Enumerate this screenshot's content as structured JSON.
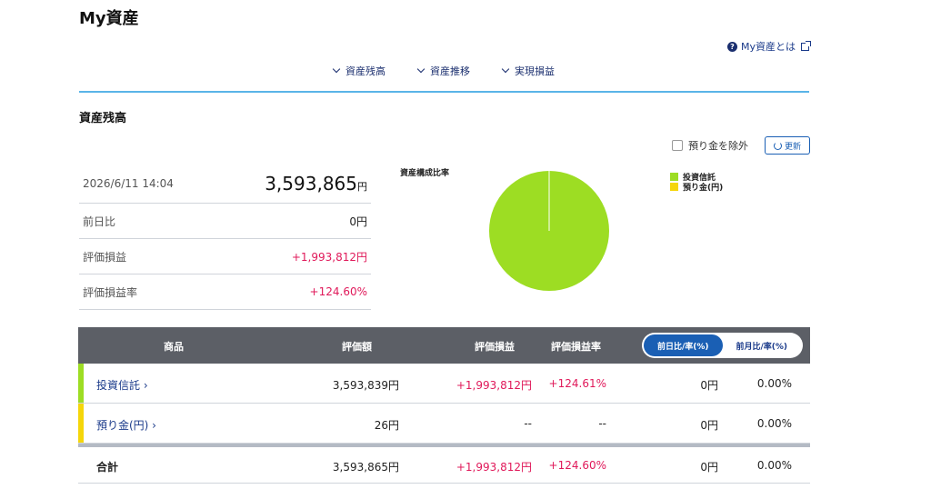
{
  "page": {
    "title": "My資産"
  },
  "help": {
    "label": "My資産とは",
    "icon": "help-icon",
    "external_icon": "external-link-icon"
  },
  "anchor_nav": [
    {
      "label": "資産残高"
    },
    {
      "label": "資産推移"
    },
    {
      "label": "実現損益"
    }
  ],
  "section": {
    "title": "資産残高"
  },
  "controls": {
    "exclude_label": "預り金を除外",
    "refresh_label": "更新"
  },
  "summary": {
    "datetime": "2026/6/11 14:04",
    "total_value": "3,593,865",
    "total_unit": "円",
    "rows": [
      {
        "label": "前日比",
        "value": "0円"
      },
      {
        "label": "評価損益",
        "value": "+1,993,812円"
      },
      {
        "label": "評価損益率",
        "value": "+124.60%"
      }
    ]
  },
  "chart_label": "資産構成比率",
  "colors": {
    "fund": "#9ddd23",
    "cash": "#f5d60a",
    "accent": "#1a5fb4",
    "gain": "#e0195a"
  },
  "chart_data": {
    "type": "pie",
    "title": "資産構成比率",
    "labels": [
      "投資信託",
      "預り金(円)"
    ],
    "values": [
      3593839,
      26
    ],
    "colors": [
      "#9ddd23",
      "#f5d60a"
    ],
    "legend": "right"
  },
  "table": {
    "headers": [
      "商品",
      "評価額",
      "評価損益",
      "評価損益率"
    ],
    "toggle": [
      "前日比/率(%)",
      "前月比/率(%)"
    ],
    "rows": [
      {
        "name": "投資信託 ›",
        "value": "3,593,839円",
        "gain": "+1,993,812円",
        "rate": "+124.61%",
        "diff": "0円",
        "diff_rate": "0.00%"
      },
      {
        "name": "預り金(円) ›",
        "value": "26円",
        "gain": "--",
        "rate": "--",
        "diff": "0円",
        "diff_rate": "0.00%"
      }
    ],
    "total": {
      "name": "合計",
      "value": "3,593,865円",
      "gain": "+1,993,812円",
      "rate": "+124.60%",
      "diff": "0円",
      "diff_rate": "0.00%"
    }
  }
}
